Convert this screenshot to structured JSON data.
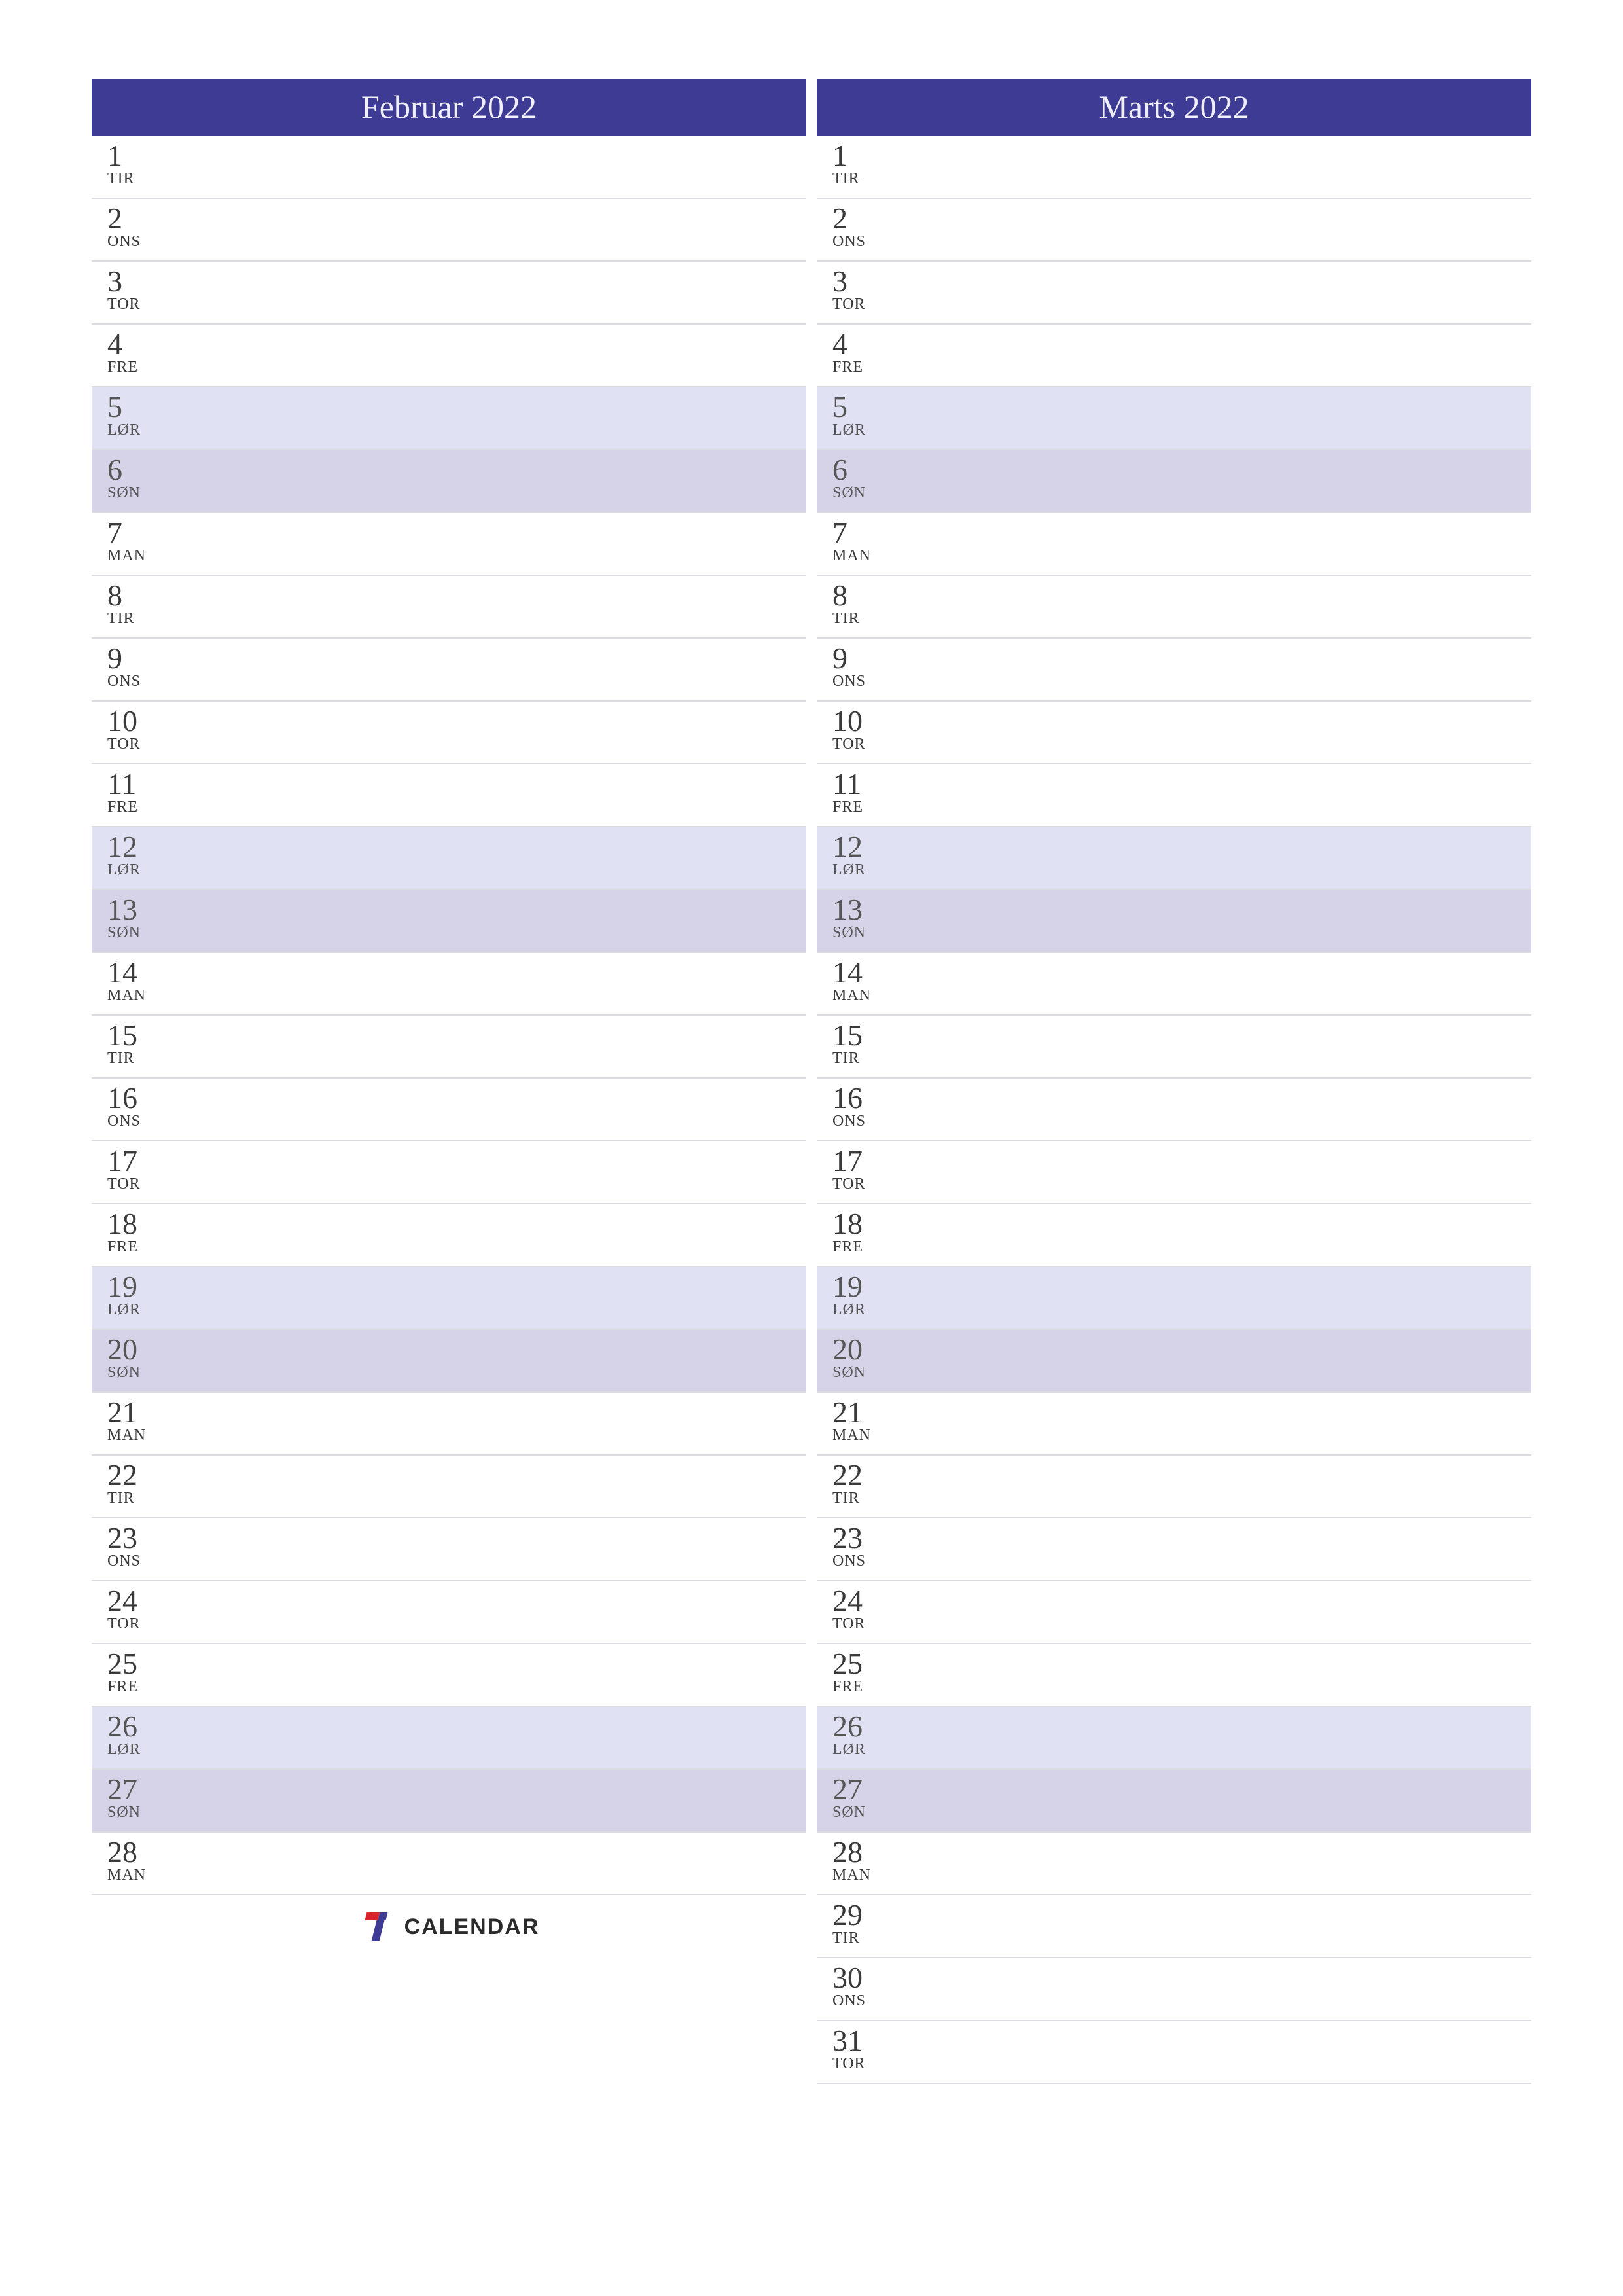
{
  "colors": {
    "header_bg": "#3d3b94",
    "header_fg": "#f0eef8",
    "sat_bg": "#e0e1f3",
    "sun_bg": "#d6d3e8"
  },
  "dow_labels": {
    "mon": "MAN",
    "tue": "TIR",
    "wed": "ONS",
    "thu": "TOR",
    "fri": "FRE",
    "sat": "LØR",
    "sun": "SØN"
  },
  "logo": {
    "text": "CALENDAR",
    "digit": "7"
  },
  "months": [
    {
      "title": "Februar 2022",
      "days": [
        {
          "num": "1",
          "dow": "TIR",
          "type": "wd"
        },
        {
          "num": "2",
          "dow": "ONS",
          "type": "wd"
        },
        {
          "num": "3",
          "dow": "TOR",
          "type": "wd"
        },
        {
          "num": "4",
          "dow": "FRE",
          "type": "wd"
        },
        {
          "num": "5",
          "dow": "LØR",
          "type": "sat"
        },
        {
          "num": "6",
          "dow": "SØN",
          "type": "sun"
        },
        {
          "num": "7",
          "dow": "MAN",
          "type": "wd"
        },
        {
          "num": "8",
          "dow": "TIR",
          "type": "wd"
        },
        {
          "num": "9",
          "dow": "ONS",
          "type": "wd"
        },
        {
          "num": "10",
          "dow": "TOR",
          "type": "wd"
        },
        {
          "num": "11",
          "dow": "FRE",
          "type": "wd"
        },
        {
          "num": "12",
          "dow": "LØR",
          "type": "sat"
        },
        {
          "num": "13",
          "dow": "SØN",
          "type": "sun"
        },
        {
          "num": "14",
          "dow": "MAN",
          "type": "wd"
        },
        {
          "num": "15",
          "dow": "TIR",
          "type": "wd"
        },
        {
          "num": "16",
          "dow": "ONS",
          "type": "wd"
        },
        {
          "num": "17",
          "dow": "TOR",
          "type": "wd"
        },
        {
          "num": "18",
          "dow": "FRE",
          "type": "wd"
        },
        {
          "num": "19",
          "dow": "LØR",
          "type": "sat"
        },
        {
          "num": "20",
          "dow": "SØN",
          "type": "sun"
        },
        {
          "num": "21",
          "dow": "MAN",
          "type": "wd"
        },
        {
          "num": "22",
          "dow": "TIR",
          "type": "wd"
        },
        {
          "num": "23",
          "dow": "ONS",
          "type": "wd"
        },
        {
          "num": "24",
          "dow": "TOR",
          "type": "wd"
        },
        {
          "num": "25",
          "dow": "FRE",
          "type": "wd"
        },
        {
          "num": "26",
          "dow": "LØR",
          "type": "sat"
        },
        {
          "num": "27",
          "dow": "SØN",
          "type": "sun"
        },
        {
          "num": "28",
          "dow": "MAN",
          "type": "wd"
        }
      ],
      "show_logo_after": true
    },
    {
      "title": "Marts 2022",
      "days": [
        {
          "num": "1",
          "dow": "TIR",
          "type": "wd"
        },
        {
          "num": "2",
          "dow": "ONS",
          "type": "wd"
        },
        {
          "num": "3",
          "dow": "TOR",
          "type": "wd"
        },
        {
          "num": "4",
          "dow": "FRE",
          "type": "wd"
        },
        {
          "num": "5",
          "dow": "LØR",
          "type": "sat"
        },
        {
          "num": "6",
          "dow": "SØN",
          "type": "sun"
        },
        {
          "num": "7",
          "dow": "MAN",
          "type": "wd"
        },
        {
          "num": "8",
          "dow": "TIR",
          "type": "wd"
        },
        {
          "num": "9",
          "dow": "ONS",
          "type": "wd"
        },
        {
          "num": "10",
          "dow": "TOR",
          "type": "wd"
        },
        {
          "num": "11",
          "dow": "FRE",
          "type": "wd"
        },
        {
          "num": "12",
          "dow": "LØR",
          "type": "sat"
        },
        {
          "num": "13",
          "dow": "SØN",
          "type": "sun"
        },
        {
          "num": "14",
          "dow": "MAN",
          "type": "wd"
        },
        {
          "num": "15",
          "dow": "TIR",
          "type": "wd"
        },
        {
          "num": "16",
          "dow": "ONS",
          "type": "wd"
        },
        {
          "num": "17",
          "dow": "TOR",
          "type": "wd"
        },
        {
          "num": "18",
          "dow": "FRE",
          "type": "wd"
        },
        {
          "num": "19",
          "dow": "LØR",
          "type": "sat"
        },
        {
          "num": "20",
          "dow": "SØN",
          "type": "sun"
        },
        {
          "num": "21",
          "dow": "MAN",
          "type": "wd"
        },
        {
          "num": "22",
          "dow": "TIR",
          "type": "wd"
        },
        {
          "num": "23",
          "dow": "ONS",
          "type": "wd"
        },
        {
          "num": "24",
          "dow": "TOR",
          "type": "wd"
        },
        {
          "num": "25",
          "dow": "FRE",
          "type": "wd"
        },
        {
          "num": "26",
          "dow": "LØR",
          "type": "sat"
        },
        {
          "num": "27",
          "dow": "SØN",
          "type": "sun"
        },
        {
          "num": "28",
          "dow": "MAN",
          "type": "wd"
        },
        {
          "num": "29",
          "dow": "TIR",
          "type": "wd"
        },
        {
          "num": "30",
          "dow": "ONS",
          "type": "wd"
        },
        {
          "num": "31",
          "dow": "TOR",
          "type": "wd"
        }
      ],
      "show_logo_after": false
    }
  ]
}
